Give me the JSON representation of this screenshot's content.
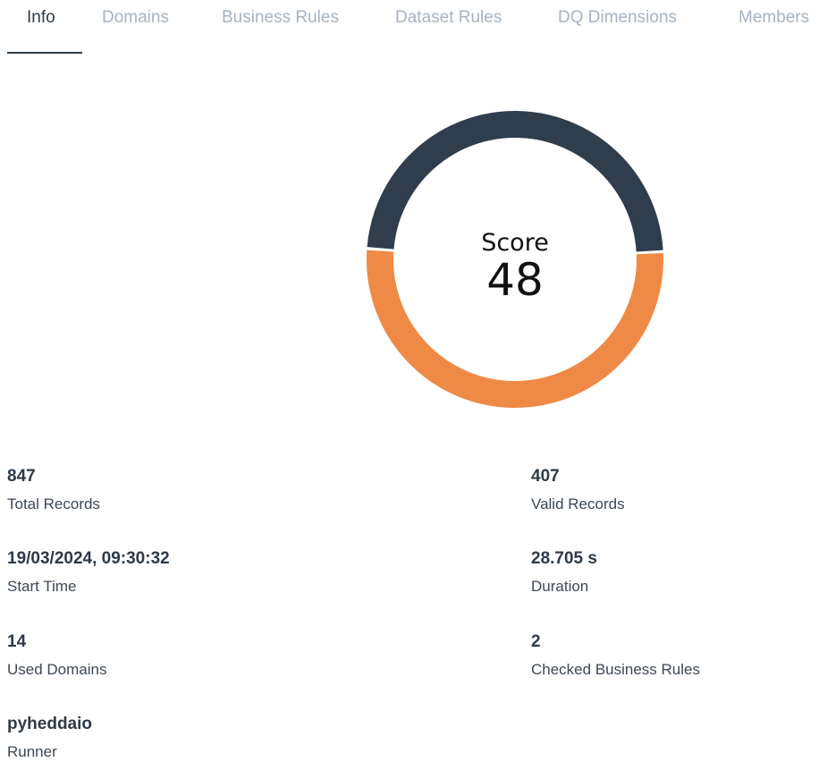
{
  "tabs": [
    {
      "label": "Info",
      "active": true
    },
    {
      "label": "Domains",
      "active": false
    },
    {
      "label": "Business Rules",
      "active": false
    },
    {
      "label": "Dataset Rules",
      "active": false
    },
    {
      "label": "DQ Dimensions",
      "active": false
    },
    {
      "label": "Members",
      "active": false
    }
  ],
  "score": {
    "label": "Score",
    "value": "48",
    "colors": {
      "valid": "#2f3d4d",
      "invalid": "#ef8a46"
    }
  },
  "stats": {
    "total_records": {
      "value": "847",
      "label": "Total Records"
    },
    "valid_records": {
      "value": "407",
      "label": "Valid Records"
    },
    "start_time": {
      "value": "19/03/2024, 09:30:32",
      "label": "Start Time"
    },
    "duration": {
      "value": "28.705 s",
      "label": "Duration"
    },
    "used_domains": {
      "value": "14",
      "label": "Used Domains"
    },
    "checked_business_rules": {
      "value": "2",
      "label": "Checked Business Rules"
    },
    "runner": {
      "value": "pyheddaio",
      "label": "Runner"
    }
  }
}
